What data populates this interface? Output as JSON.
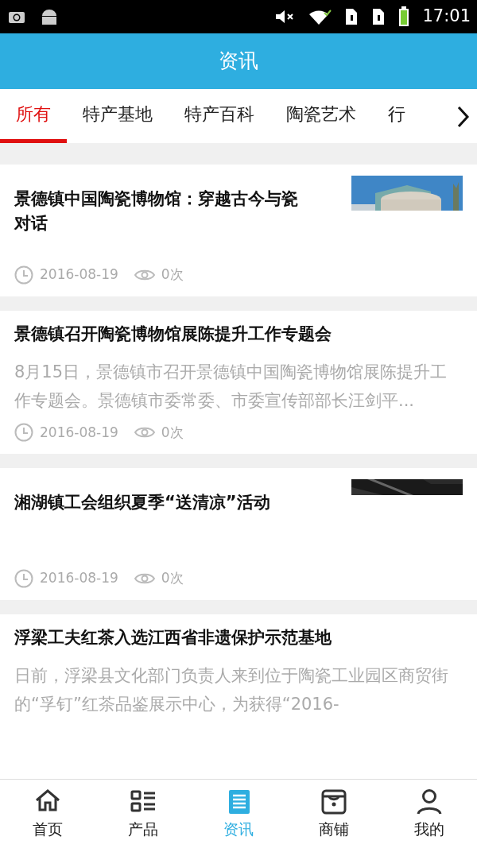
{
  "status_bar": {
    "time": "17:01"
  },
  "header": {
    "title": "资讯"
  },
  "tabs": [
    {
      "label": "所有",
      "selected": true
    },
    {
      "label": "特产基地",
      "selected": false
    },
    {
      "label": "特产百科",
      "selected": false
    },
    {
      "label": "陶瓷艺术",
      "selected": false
    },
    {
      "label": "行",
      "selected": false
    }
  ],
  "articles": [
    {
      "title": "景德镇中国陶瓷博物馆：穿越古今与瓷对话",
      "date": "2016-08-19",
      "views": "0次"
    },
    {
      "title": "景德镇召开陶瓷博物馆展陈提升工作专题会",
      "summary": "8月15日，景德镇市召开景德镇中国陶瓷博物馆展陈提升工作专题会。景德镇市委常委、市委宣传部部长汪剑平...",
      "date": "2016-08-19",
      "views": "0次"
    },
    {
      "title": "湘湖镇工会组织夏季“送清凉”活动",
      "date": "2016-08-19",
      "views": "0次"
    },
    {
      "title": "浮梁工夫红茶入选江西省非遗保护示范基地",
      "summary": "日前，浮梁县文化部门负责人来到位于陶瓷工业园区商贸街的“孚钉”红茶品鉴展示中心，为获得“2016-"
    }
  ],
  "bottom_nav": [
    {
      "label": "首页",
      "selected": false
    },
    {
      "label": "产品",
      "selected": false
    },
    {
      "label": "资讯",
      "selected": true
    },
    {
      "label": "商铺",
      "selected": false
    },
    {
      "label": "我的",
      "selected": false
    }
  ]
}
